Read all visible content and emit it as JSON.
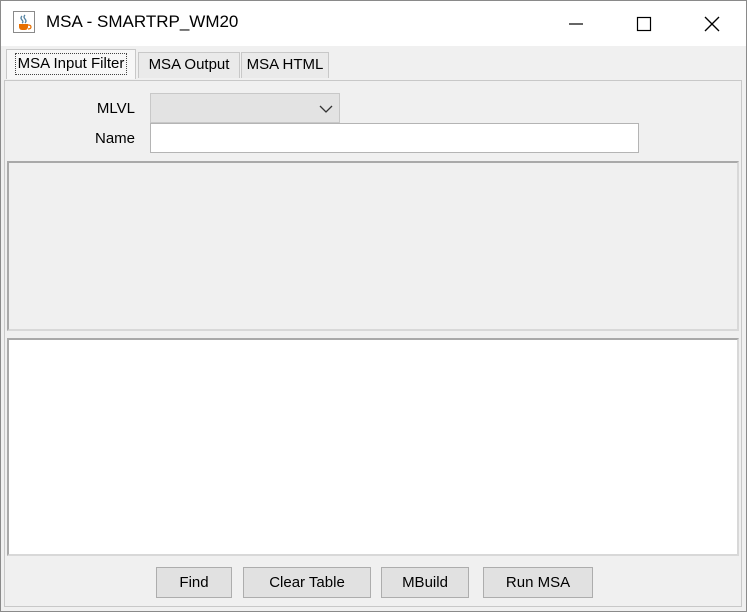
{
  "window": {
    "title": "MSA - SMARTRP_WM20",
    "icon": "java-cup-icon",
    "controls": [
      "minimize-icon",
      "maximize-icon",
      "close-icon"
    ]
  },
  "tabs": [
    {
      "label": "MSA Input Filter",
      "active": true
    },
    {
      "label": "MSA Output",
      "active": false
    },
    {
      "label": "MSA HTML",
      "active": false
    }
  ],
  "form": {
    "mlvl_label": "MLVL",
    "mlvl_value": "",
    "name_label": "Name",
    "name_value": ""
  },
  "buttons": {
    "find": "Find",
    "clear_table": "Clear Table",
    "mbuild": "MBuild",
    "run_msa": "Run MSA"
  },
  "colors": {
    "window_bg": "#f0f0f0",
    "button_bg": "#e1e1e1",
    "combo_bg": "#e3e3e3"
  }
}
